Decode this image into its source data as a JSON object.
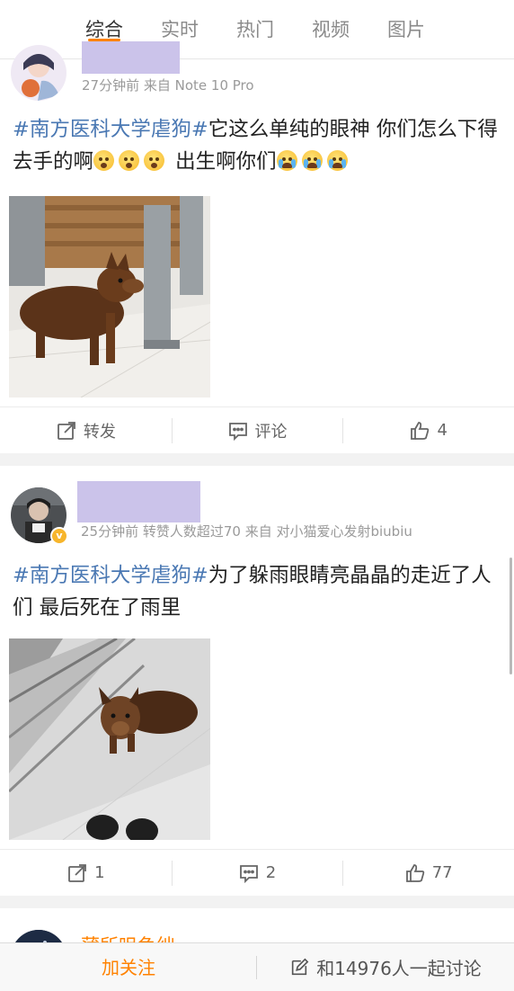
{
  "tabs": [
    "综合",
    "实时",
    "热门",
    "视频",
    "图片"
  ],
  "active_tab": "综合",
  "accent_color": "#ff8200",
  "hashtag_color": "#4a78b3",
  "posts": [
    {
      "meta": "27分钟前 来自 Note 10 Pro",
      "hashtag": "#南方医科大学虐狗#",
      "text_main": "它这么单纯的眼神 你们怎么下得去手的啊",
      "emojis_1": [
        "surprised-emoji",
        "surprised-emoji",
        "surprised-emoji"
      ],
      "text_tail": " 出生啊你们",
      "emojis_2": [
        "crying-emoji",
        "crying-emoji",
        "crying-emoji"
      ],
      "repost_label": "转发",
      "comment_label": "评论",
      "like_count": "4"
    },
    {
      "meta": "25分钟前 转赞人数超过70 来自 对小猫爱心发射biubiu",
      "hashtag": "#南方医科大学虐狗#",
      "text_main": "为了躲雨眼睛亮晶晶的走近了人们 最后死在了雨里",
      "repost_count": "1",
      "comment_count": "2",
      "like_count": "77",
      "verified_badge": "v"
    },
    {
      "name_partial": "蒲所咀鱼绌"
    }
  ],
  "bottom_bar": {
    "follow_label": "加关注",
    "discuss_label": "和14976人一起讨论"
  }
}
